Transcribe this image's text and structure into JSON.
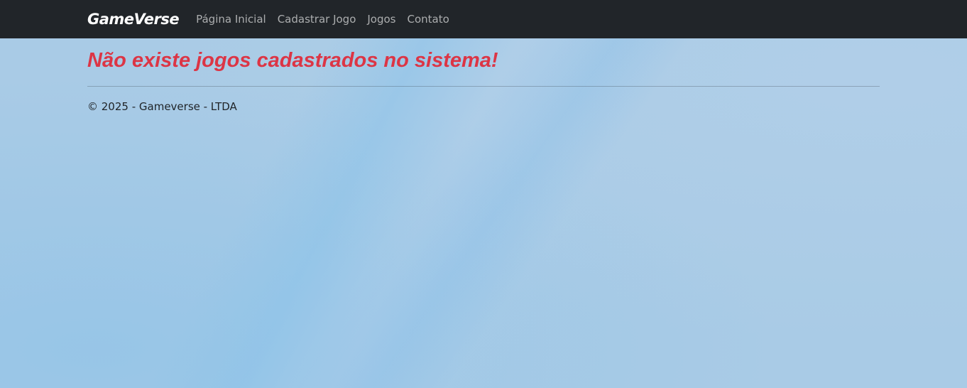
{
  "navbar": {
    "brand": "GameVerse",
    "links": [
      {
        "label": "Página Inicial"
      },
      {
        "label": "Cadastrar Jogo"
      },
      {
        "label": "Jogos"
      },
      {
        "label": "Contato"
      }
    ]
  },
  "main": {
    "empty_message": "Não existe jogos cadastrados no sistema!"
  },
  "footer": {
    "text": "© 2025 - Gameverse - LTDA"
  },
  "colors": {
    "navbar_bg": "#212529",
    "alert_text": "#dc3545",
    "page_bg": "#a9cbe6"
  }
}
